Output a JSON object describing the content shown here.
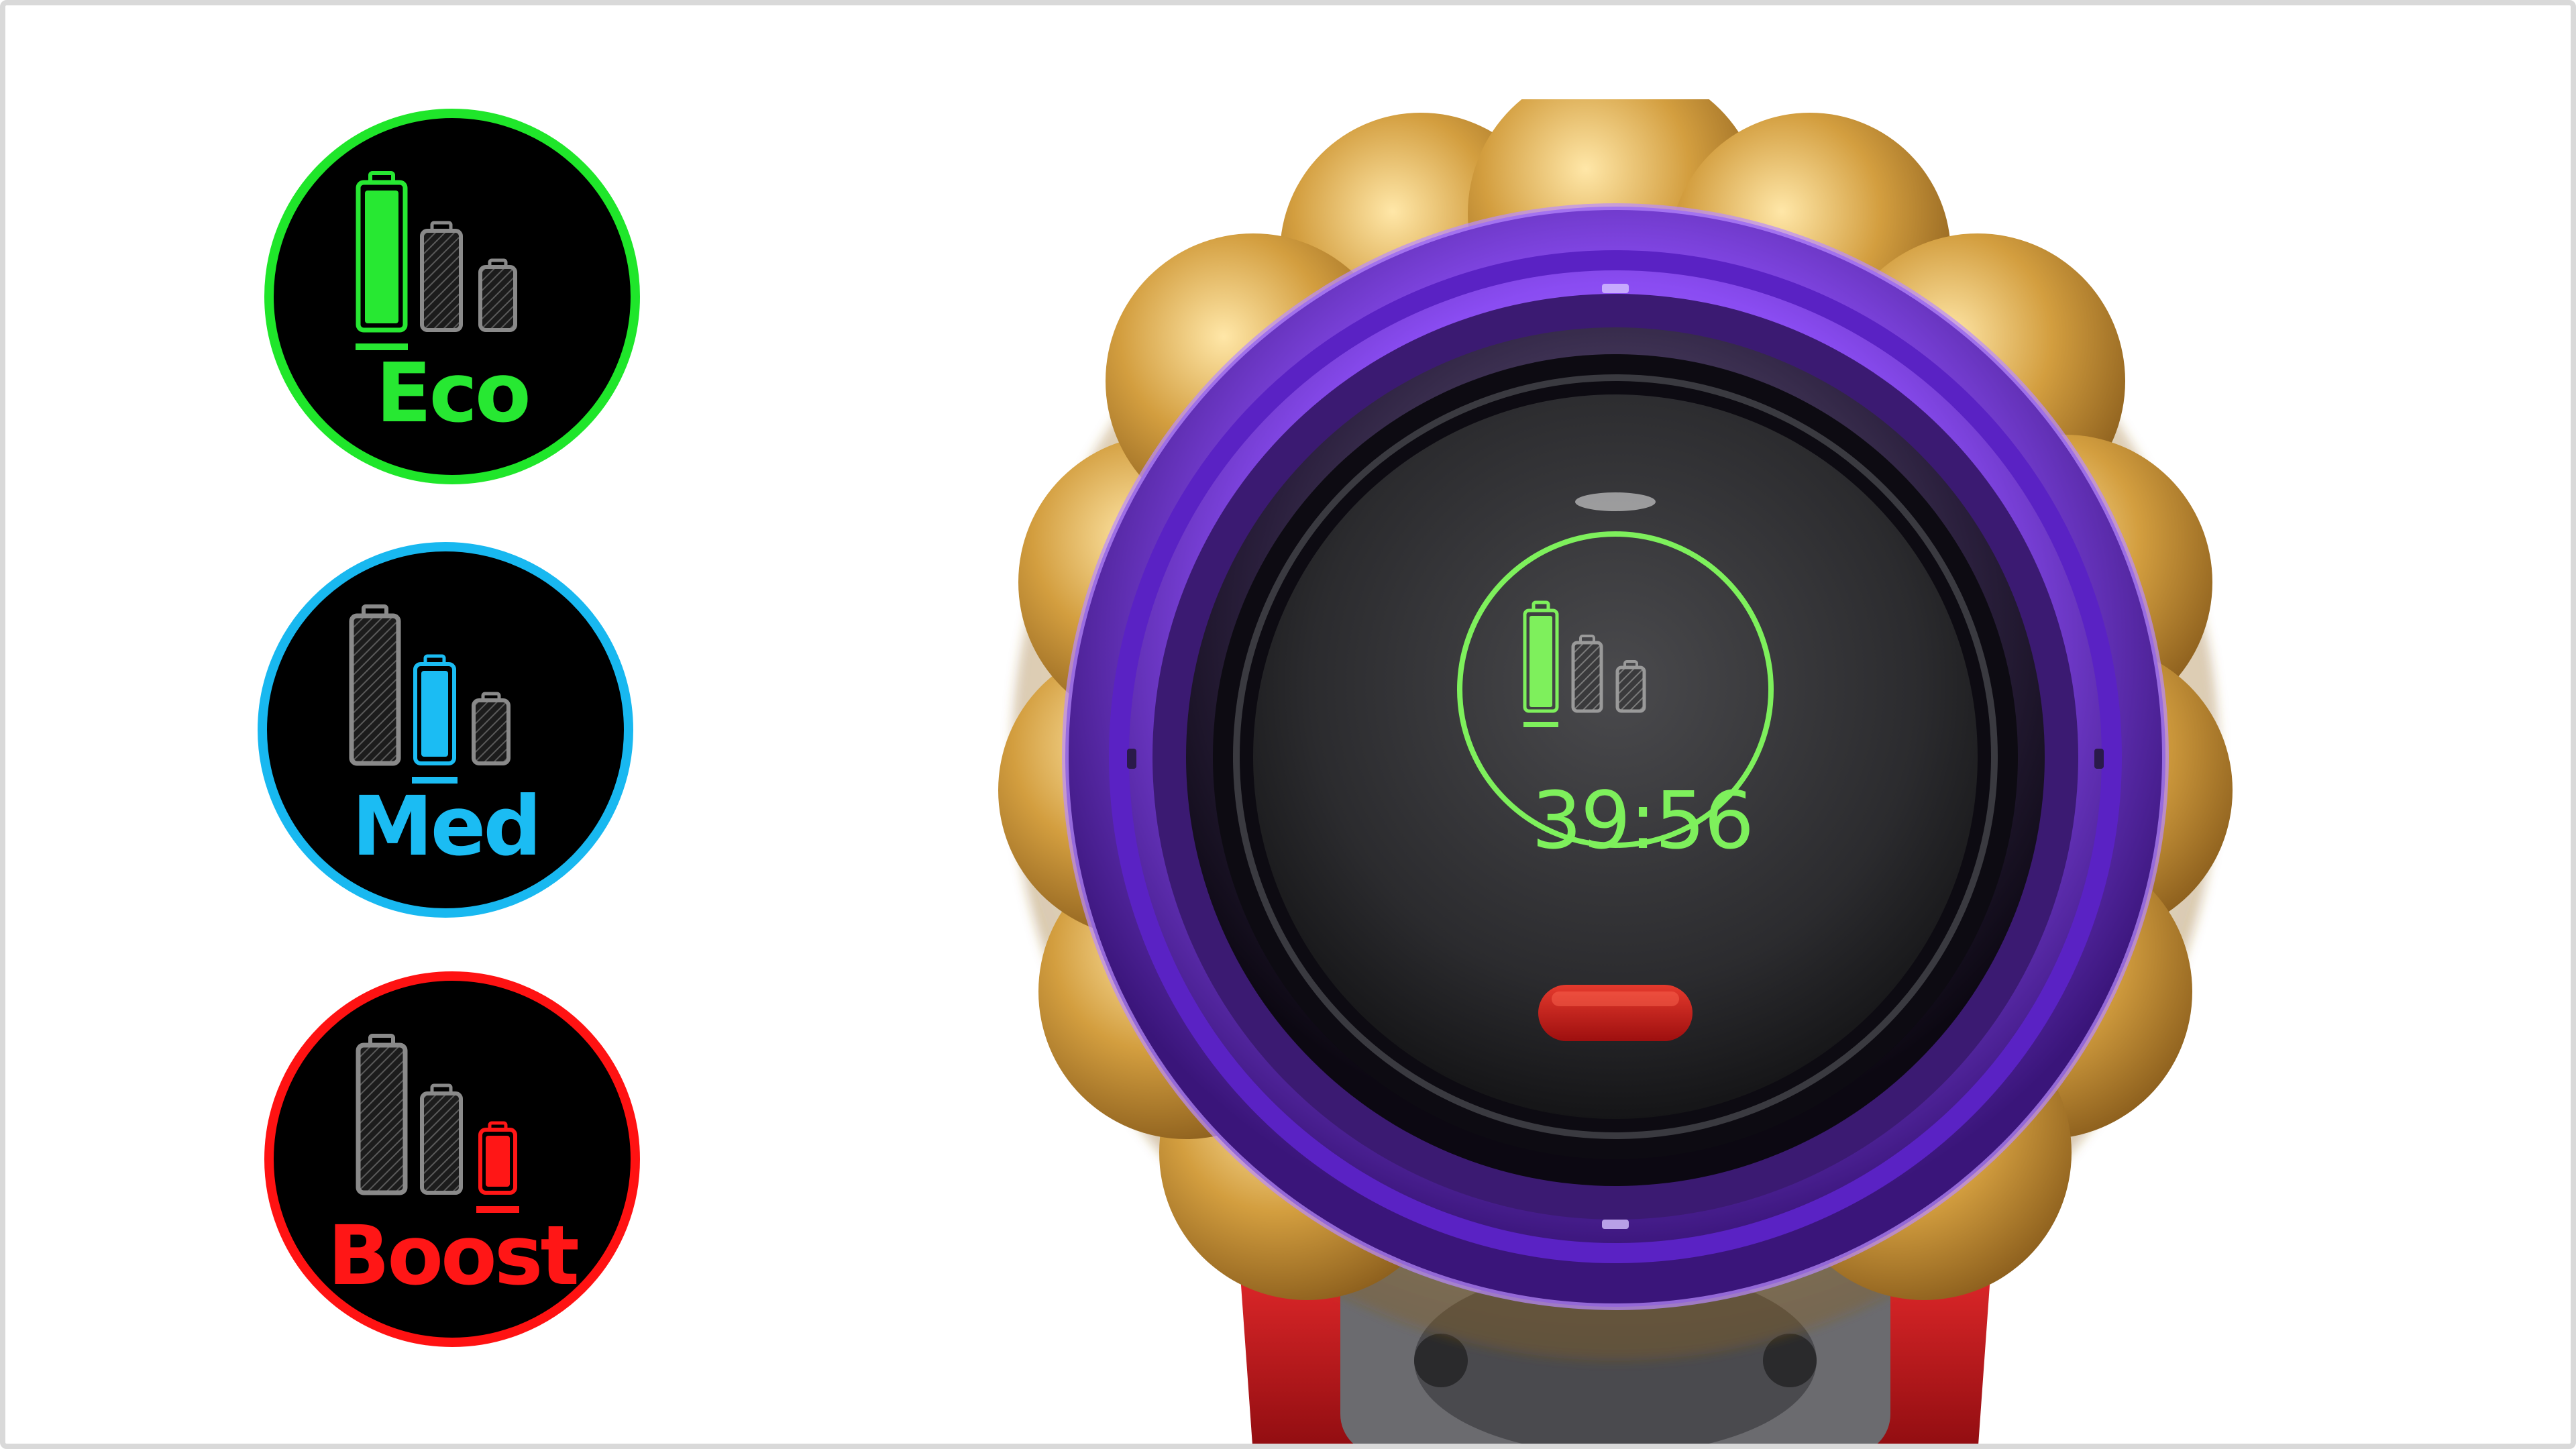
{
  "modes": [
    {
      "name": "eco",
      "label": "Eco",
      "color": "#27e832",
      "active_battery": 1
    },
    {
      "name": "med",
      "label": "Med",
      "color": "#1bbcf3",
      "active_battery": 2
    },
    {
      "name": "boost",
      "label": "Boost",
      "color": "#ff1616",
      "active_battery": 3
    }
  ],
  "device": {
    "runtime": "39:56",
    "display_color": "#7ef05c",
    "ring_color": "#7b3cf0",
    "body_color": "#c99a3a",
    "button_color": "#c4151b",
    "icon": "battery-modes-icon"
  }
}
